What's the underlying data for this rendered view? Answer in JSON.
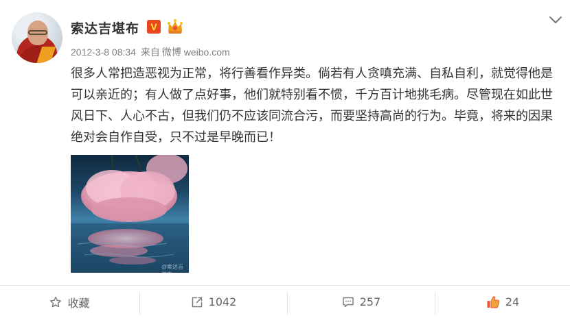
{
  "post": {
    "author": "索达吉堪布",
    "verified_badge": "V",
    "timestamp": "2012-3-8 08:34",
    "source_prefix": "来自",
    "source": "微博 weibo.com",
    "text": "很多人常把造恶视为正常，将行善看作异类。倘若有人贪嗔充满、自私自利，就觉得他是可以亲近的；有人做了点好事，他们就特别看不惯，千方百计地挑毛病。尽管现在如此世风日下、人心不古，但我们仍不应该同流合污，而要坚持高尚的行为。毕竟，将来的因果绝对会自作自受，只不过是早晚而已！",
    "image_watermark": "@索达吉堪布"
  },
  "actions": {
    "favorite": {
      "icon": "star-icon",
      "label": "收藏"
    },
    "repost": {
      "icon": "share-icon",
      "count": "1042"
    },
    "comment": {
      "icon": "comment-icon",
      "count": "257"
    },
    "like": {
      "icon": "thumbs-up-icon",
      "count": "24"
    }
  },
  "colors": {
    "verified_badge": "#e8471f",
    "like_icon": "#e8553a",
    "meta_text": "#808080"
  }
}
